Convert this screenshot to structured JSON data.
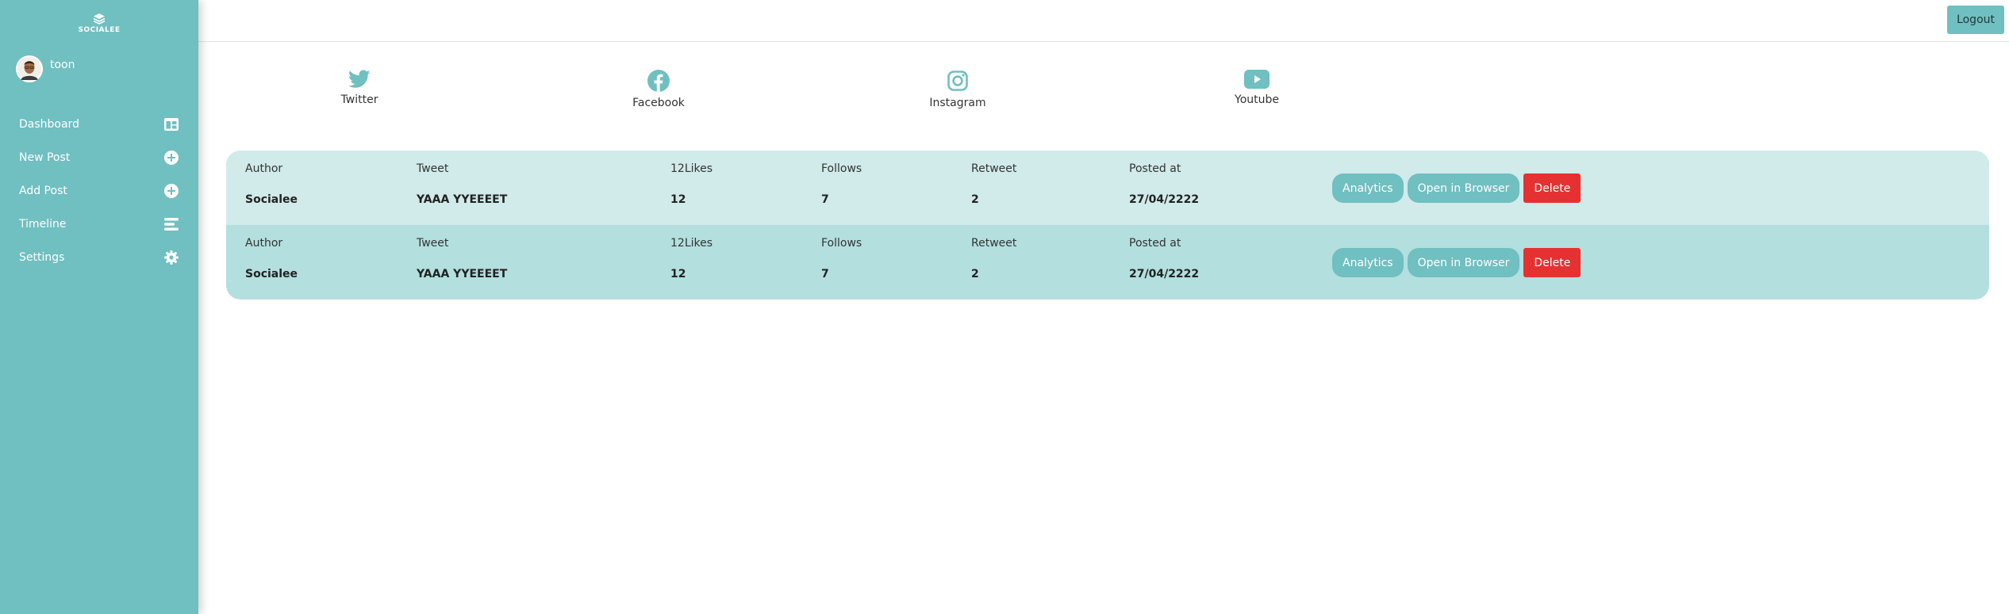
{
  "brand": {
    "name": "SOCIALEE"
  },
  "user": {
    "name": "toon"
  },
  "sidebar": {
    "items": [
      {
        "label": "Dashboard",
        "icon": "dashboard-icon"
      },
      {
        "label": "New Post",
        "icon": "plus-circle-icon"
      },
      {
        "label": "Add Post",
        "icon": "plus-circle-icon"
      },
      {
        "label": "Timeline",
        "icon": "timeline-icon"
      },
      {
        "label": "Settings",
        "icon": "gear-icon"
      }
    ]
  },
  "topbar": {
    "logout_label": "Logout"
  },
  "socials": [
    {
      "label": "Twitter",
      "icon": "twitter-icon"
    },
    {
      "label": "Facebook",
      "icon": "facebook-icon"
    },
    {
      "label": "Instagram",
      "icon": "instagram-icon"
    },
    {
      "label": "Youtube",
      "icon": "youtube-icon"
    }
  ],
  "table": {
    "headers": [
      "Author",
      "Tweet",
      "12Likes",
      "Follows",
      "Retweet",
      "Posted at"
    ],
    "rows": [
      {
        "author": "Socialee",
        "tweet": "YAAA YYEEEET",
        "likes": "12",
        "follows": "7",
        "retweet": "2",
        "posted": "27/04/2222"
      },
      {
        "author": "Socialee",
        "tweet": "YAAA YYEEEET",
        "likes": "12",
        "follows": "7",
        "retweet": "2",
        "posted": "27/04/2222"
      }
    ],
    "actions": {
      "analytics": "Analytics",
      "open": "Open in Browser",
      "delete": "Delete"
    }
  },
  "colors": {
    "accent": "#70bfc1",
    "row_light": "#d1eaea",
    "row_dark": "#b3dfdf",
    "danger": "#e53131"
  }
}
